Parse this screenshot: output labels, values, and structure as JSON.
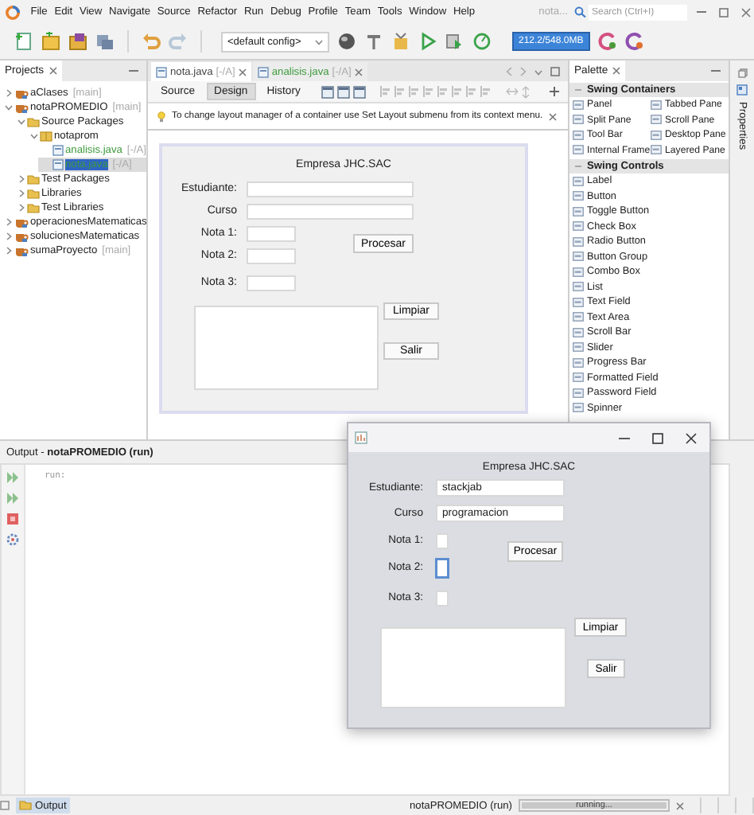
{
  "menu_bar": {
    "items": [
      "File",
      "Edit",
      "View",
      "Navigate",
      "Source",
      "Refactor",
      "Run",
      "Debug",
      "Profile",
      "Team",
      "Tools",
      "Window",
      "Help"
    ],
    "title": "nota...",
    "search": {
      "placeholder": "Search (Ctrl+I)"
    }
  },
  "toolbar": {
    "config": "<default config>",
    "memory": "212.2/548.0MB"
  },
  "projects": {
    "title": "Projects",
    "tree": [
      {
        "label": "aClases",
        "branch": "[main]",
        "kind": "project",
        "expanded": false,
        "selected": false
      },
      {
        "label": "notaPROMEDIO",
        "branch": "[main]",
        "kind": "project",
        "expanded": true,
        "selected": false,
        "children": [
          {
            "label": "Source Packages",
            "kind": "folder",
            "expanded": true,
            "selected": false,
            "children": [
              {
                "label": "notaprom",
                "kind": "package",
                "expanded": true,
                "selected": false,
                "children": [
                  {
                    "label": "analisis.java",
                    "branch": "[-/A]",
                    "kind": "file",
                    "new": true,
                    "selected": false
                  },
                  {
                    "label": "nota.java",
                    "branch": "[-/A]",
                    "kind": "file",
                    "new": true,
                    "selected": true
                  }
                ]
              }
            ]
          },
          {
            "label": "Test Packages",
            "kind": "folder",
            "expanded": false,
            "selected": false
          },
          {
            "label": "Libraries",
            "kind": "folder",
            "expanded": false,
            "selected": false
          },
          {
            "label": "Test Libraries",
            "kind": "folder",
            "expanded": false,
            "selected": false
          }
        ]
      },
      {
        "label": "operacionesMatematicas",
        "kind": "project",
        "expanded": false,
        "selected": false
      },
      {
        "label": "solucionesMatematicas",
        "kind": "project",
        "expanded": false,
        "selected": false
      },
      {
        "label": "sumaProyecto",
        "branch": "[main]",
        "kind": "project",
        "expanded": false,
        "selected": false
      }
    ]
  },
  "editor": {
    "tabs": [
      {
        "label": "nota.java",
        "branch": "[-/A]",
        "new": false,
        "selected": true
      },
      {
        "label": "analisis.java",
        "branch": "[-/A]",
        "new": true,
        "selected": false
      }
    ],
    "views": [
      {
        "label": "Source",
        "selected": false
      },
      {
        "label": "Design",
        "selected": true
      },
      {
        "label": "History",
        "selected": false
      }
    ],
    "hint": "To change layout manager of a container use Set Layout submenu from its context menu.",
    "form": {
      "title": "Empresa JHC.SAC",
      "fields": [
        {
          "label": "Estudiante:"
        },
        {
          "label": "Curso"
        },
        {
          "label": "Nota 1:"
        },
        {
          "label": "Nota 2:"
        },
        {
          "label": "Nota 3:"
        }
      ],
      "buttons": [
        "Procesar",
        "Limpiar",
        "Salir"
      ]
    }
  },
  "palette": {
    "title": "Palette",
    "sections": [
      {
        "title": "Swing Containers",
        "kind": "grid",
        "expanded": true,
        "items": [
          "Panel",
          "Tabbed Pane",
          "Split Pane",
          "Scroll Pane",
          "Tool Bar",
          "Desktop Pane",
          "Internal Frame",
          "Layered Pane"
        ]
      },
      {
        "title": "Swing Controls",
        "kind": "list",
        "expanded": true,
        "items": [
          "Label",
          "Button",
          "Toggle Button",
          "Check Box",
          "Radio Button",
          "Button Group",
          "Combo Box",
          "List",
          "Text Field",
          "Text Area",
          "Scroll Bar",
          "Slider",
          "Progress Bar",
          "Formatted Field",
          "Password Field",
          "Spinner"
        ]
      }
    ]
  },
  "properties": {
    "title": "Properties"
  },
  "output": {
    "title": "Output - **notaPROMEDIO (run)**",
    "lines": [
      "run:"
    ]
  },
  "status_bar": {
    "tab": "Output",
    "task": "notaPROMEDIO (run)",
    "progress": "running...",
    "level": 1
  },
  "app_window": {
    "form": {
      "title": "Empresa JHC.SAC",
      "fields": [
        {
          "label": "Estudiante:",
          "value": "stackjab",
          "focused": false
        },
        {
          "label": "Curso",
          "value": "programacion",
          "focused": false
        },
        {
          "label": "Nota 1:",
          "focused": false
        },
        {
          "label": "Nota 2:",
          "focused": true
        },
        {
          "label": "Nota 3:",
          "focused": false
        }
      ],
      "buttons": [
        "Procesar",
        "Limpiar",
        "Salir"
      ]
    }
  }
}
